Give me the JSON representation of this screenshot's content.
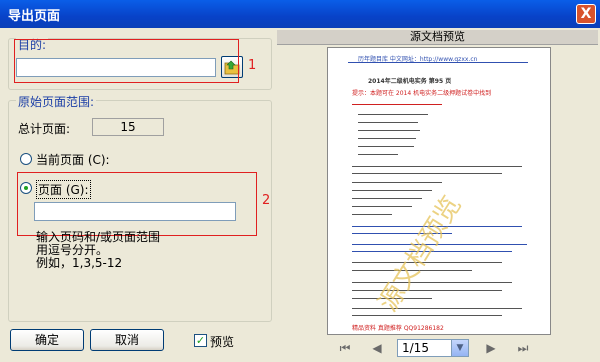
{
  "window": {
    "title": "导出页面",
    "close_label": "X"
  },
  "destination": {
    "label": "目的:",
    "value": "",
    "marker": "1"
  },
  "range": {
    "group_label": "原始页面范围:",
    "total_label": "总计页面:",
    "total_value": "15",
    "current_label": "当前页面 (C):",
    "pages_label": "页面 (G):",
    "pages_value": "",
    "marker": "2",
    "hint_line1": "输入页码和/或页面范围",
    "hint_line2": "用逗号分开。",
    "hint_line3": "例如，1,3,5-12"
  },
  "buttons": {
    "ok": "确定",
    "cancel": "取消"
  },
  "preview_check": {
    "label": "预览",
    "checked": true
  },
  "preview": {
    "header": "源文档预览",
    "doc_header": "历年题目库 中文网址：http://www.qzxx.cn",
    "doc_title": "2014年二级机电实务  第95 页",
    "doc_red": "提示：本题可在 2014 机电实务二级押题试卷中找到",
    "watermark": "源文档预览",
    "doc_footer": "精品资料  真题推荐 QQ91286182"
  },
  "nav": {
    "first": "⏮",
    "prev": "◀",
    "page_value": "1/15",
    "next": "▶",
    "last": "⏭",
    "dropdown_icon": "▼"
  }
}
